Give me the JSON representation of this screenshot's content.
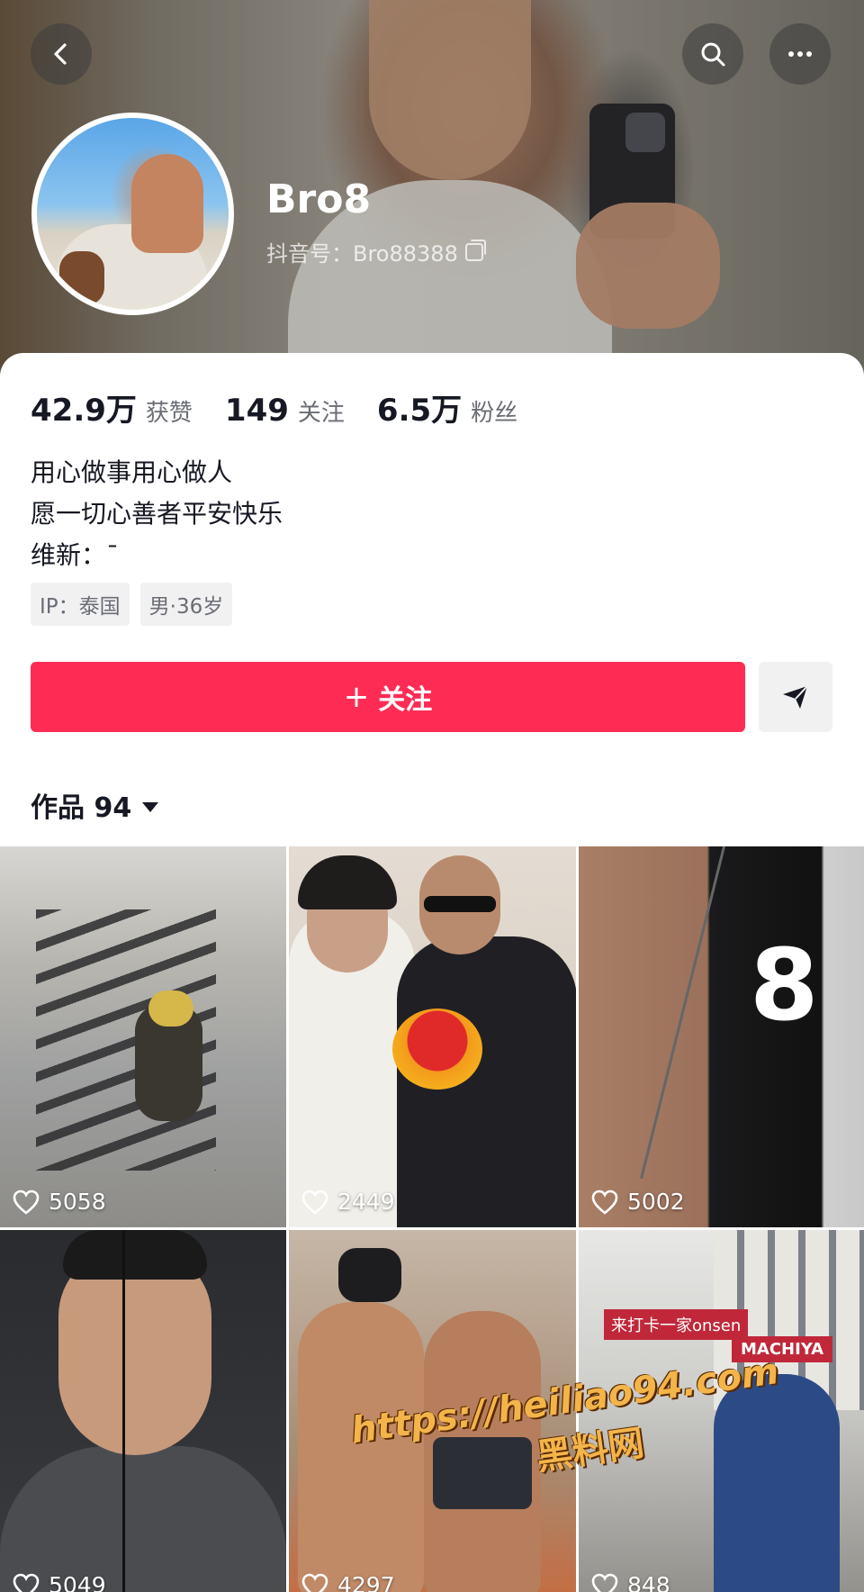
{
  "header": {
    "nickname": "Bro8",
    "account_id": "抖音号：Bro88388"
  },
  "icons": {
    "back": "back-arrow-icon",
    "search": "search-icon",
    "more": "more-icon",
    "copy": "copy-icon",
    "share": "share-icon",
    "heart": "heart-icon"
  },
  "stats": [
    {
      "value": "42.9万",
      "label": "获赞"
    },
    {
      "value": "149",
      "label": "关注"
    },
    {
      "value": "6.5万",
      "label": "粉丝"
    }
  ],
  "bio": {
    "lines": [
      "用心做事用心做人",
      "愿一切心善者平安快乐",
      "维新：¯"
    ]
  },
  "tags": [
    "IP：泰国",
    "男·36岁"
  ],
  "actions": {
    "follow_plus": "+",
    "follow_label": "关注"
  },
  "works": {
    "label": "作品 94"
  },
  "videos": [
    {
      "likes": "5058"
    },
    {
      "likes": "2449"
    },
    {
      "likes": "5002"
    },
    {
      "likes": "5049"
    },
    {
      "likes": "4297"
    },
    {
      "likes": "848"
    }
  ],
  "tile_text": {
    "eight": "8",
    "sign_a": "来打卡一家onsen",
    "sign_b": "MACHIYA"
  },
  "watermark": {
    "url": "https://heiliao94.com",
    "cn": "黑料网"
  },
  "colors": {
    "accent": "#fe2c55",
    "text": "#161823",
    "muted": "#6b6d75"
  }
}
